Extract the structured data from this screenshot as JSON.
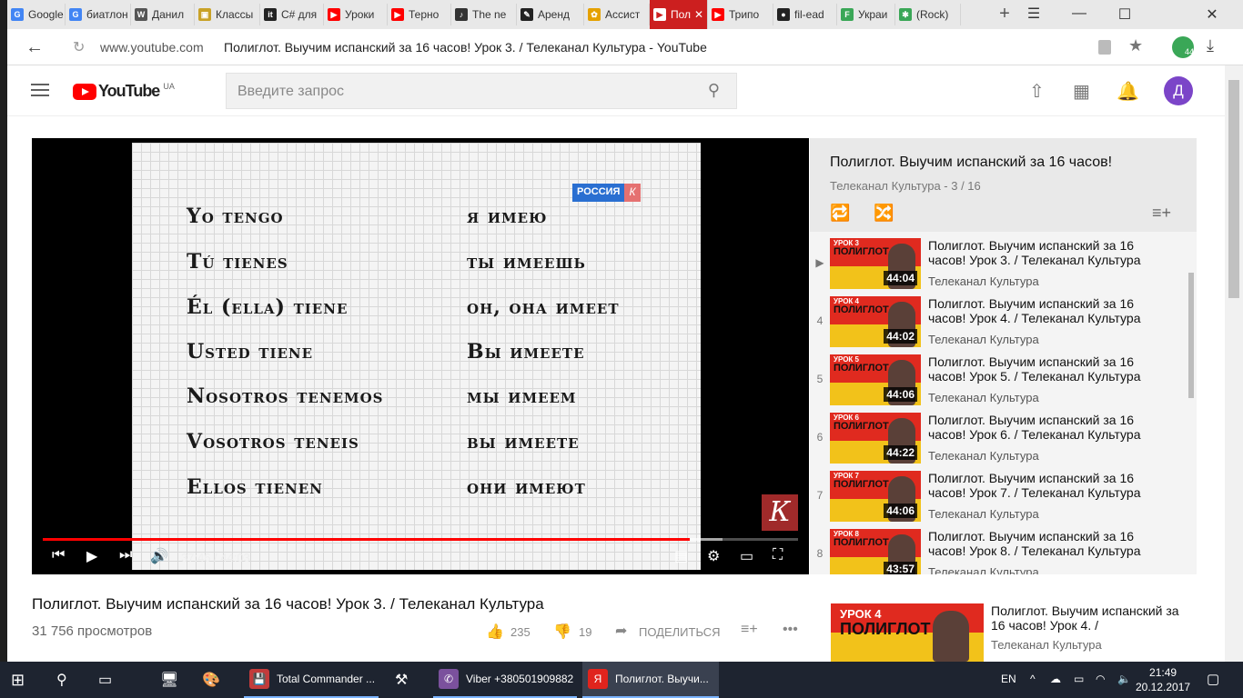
{
  "tabs": [
    {
      "label": "Google",
      "color": "#4285f4",
      "glyph": "G"
    },
    {
      "label": "биатлон",
      "color": "#4285f4",
      "glyph": "G"
    },
    {
      "label": "Данил",
      "color": "#555555",
      "glyph": "W"
    },
    {
      "label": "Классы",
      "color": "#c9a227",
      "glyph": "▣"
    },
    {
      "label": "C# для",
      "color": "#222222",
      "glyph": "it"
    },
    {
      "label": "Уроки",
      "color": "#ff0000",
      "glyph": "▶"
    },
    {
      "label": "Терно",
      "color": "#ff0000",
      "glyph": "▶"
    },
    {
      "label": "The ne",
      "color": "#333333",
      "glyph": "♪"
    },
    {
      "label": "Аренд",
      "color": "#222222",
      "glyph": "✎"
    },
    {
      "label": "Ассист",
      "color": "#e5a100",
      "glyph": "✿"
    },
    {
      "label": "Пол",
      "color": "#ff0000",
      "glyph": "▶",
      "active": true
    },
    {
      "label": "Трипо",
      "color": "#ff0000",
      "glyph": "▶"
    },
    {
      "label": "fil-ead",
      "color": "#222222",
      "glyph": "●"
    },
    {
      "label": "Украи",
      "color": "#3aa757",
      "glyph": "F"
    },
    {
      "label": "(Rock)",
      "color": "#3aa757",
      "glyph": "✱"
    }
  ],
  "address": {
    "host": "www.youtube.com",
    "page_title": "Полиглот. Выучим испанский за 16 часов! Урок 3. / Телеканал Культура - YouTube",
    "ext_badge": "44"
  },
  "youtube": {
    "logo_text": "YouTube",
    "region": "UA",
    "search_placeholder": "Введите запрос",
    "avatar_letter": "Д"
  },
  "video": {
    "left_column": [
      "Yo tengo",
      "Tú tienes",
      "Él (ella)  tiene",
      "Usted tiene",
      "Nosotros tenemos",
      "Vosotros teneis",
      "Ellos tienen"
    ],
    "right_column": [
      "я имею",
      "ты имеешь",
      "он, она имеет",
      "Вы имеете",
      "мы имеем",
      "вы имеете",
      "они имеют"
    ],
    "channel_bug": "РОССИЯ",
    "channel_bug_k": "К",
    "corner_logo": "К",
    "time_current": "37:46",
    "time_total": "44:03",
    "time_display": "37:46 / 44:03",
    "progress_fraction": 0.857,
    "buffered_fraction": 0.9
  },
  "playlist": {
    "title": "Полиглот. Выучим испанский за 16 часов!",
    "subtitle": "Телеканал Культура - 3 / 16",
    "items": [
      {
        "index": "▶",
        "lesson": "УРОК 3",
        "title": "Полиглот. Выучим испанский за 16 часов! Урок 3. / Телеканал Культура",
        "channel": "Телеканал Культура",
        "duration": "44:04"
      },
      {
        "index": "4",
        "lesson": "УРОК 4",
        "title": "Полиглот. Выучим испанский за 16 часов! Урок 4. / Телеканал Культура",
        "channel": "Телеканал Культура",
        "duration": "44:02"
      },
      {
        "index": "5",
        "lesson": "УРОК 5",
        "title": "Полиглот. Выучим испанский за 16 часов! Урок 5. / Телеканал Культура",
        "channel": "Телеканал Культура",
        "duration": "44:06"
      },
      {
        "index": "6",
        "lesson": "УРОК 6",
        "title": "Полиглот. Выучим испанский за 16 часов! Урок 6. / Телеканал Культура",
        "channel": "Телеканал Культура",
        "duration": "44:22"
      },
      {
        "index": "7",
        "lesson": "УРОК 7",
        "title": "Полиглот. Выучим испанский за 16 часов! Урок 7. / Телеканал Культура",
        "channel": "Телеканал Культура",
        "duration": "44:06"
      },
      {
        "index": "8",
        "lesson": "УРОК 8",
        "title": "Полиглот. Выучим испанский за 16 часов! Урок 8. / Телеканал Культура",
        "channel": "Телеканал Культура",
        "duration": "43:57"
      }
    ],
    "thumb_text": "ПОЛИГЛОТ"
  },
  "below": {
    "title": "Полиглот. Выучим испанский за 16 часов! Урок 3. / Телеканал Культура",
    "views": "31 756 просмотров",
    "likes": "235",
    "dislikes": "19",
    "share": "ПОДЕЛИТЬСЯ"
  },
  "up_next": {
    "lesson": "УРОК 4",
    "thumb_text": "ПОЛИГЛОТ",
    "title": "Полиглот. Выучим испанский за 16 часов! Урок 4. /",
    "channel": "Телеканал Культура"
  },
  "taskbar": {
    "apps": [
      {
        "label": "Total Commander ...",
        "color": "#c33b3b",
        "glyph": "💾"
      },
      {
        "label": "Viber +380501909882",
        "color": "#7b519d",
        "glyph": "✆"
      },
      {
        "label": "Полиглот. Выучи...",
        "color": "#e0241d",
        "glyph": "Я"
      }
    ],
    "lang": "EN",
    "time": "21:49",
    "date": "20.12.2017"
  }
}
